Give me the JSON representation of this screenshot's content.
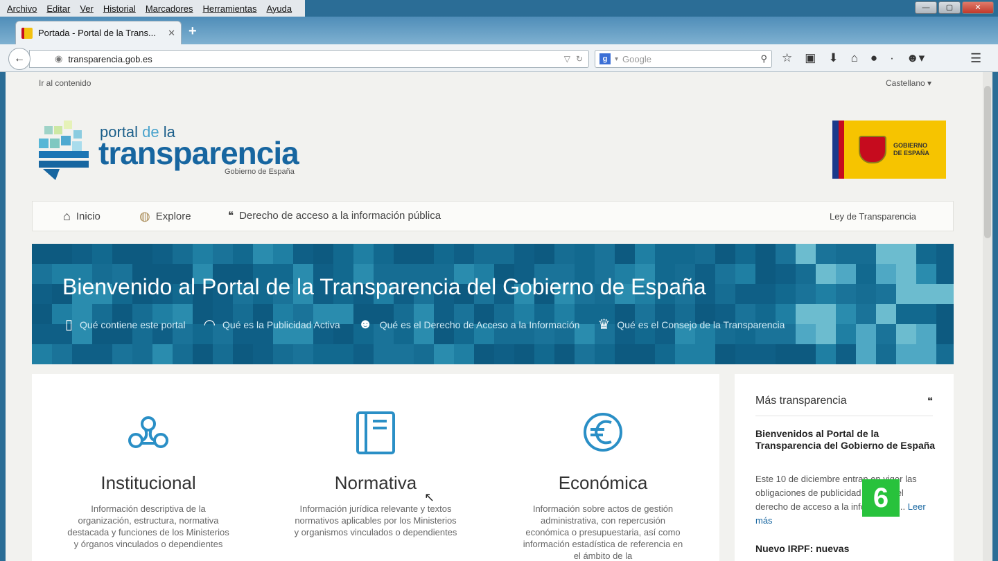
{
  "browser": {
    "menu": [
      "Archivo",
      "Editar",
      "Ver",
      "Historial",
      "Marcadores",
      "Herramientas",
      "Ayuda"
    ],
    "tab_title": "Portada - Portal de la Trans...",
    "url": "transparencia.gob.es",
    "search_placeholder": "Google"
  },
  "page": {
    "skip_link": "Ir al contenido",
    "language": "Castellano ▾",
    "logo": {
      "line1_a": "portal ",
      "line1_b": "de",
      "line1_c": " la",
      "line2": "transparencia",
      "sub": "Gobierno de España"
    },
    "gov_seal": {
      "line1": "GOBIERNO",
      "line2": "DE ESPAÑA"
    },
    "nav": {
      "inicio": "Inicio",
      "explore": "Explore",
      "derecho": "Derecho de acceso a la información pública",
      "ley": "Ley de Transparencia"
    },
    "hero": {
      "title": "Bienvenido al Portal de la Transparencia del Gobierno de España",
      "links": [
        "Qué contiene este portal",
        "Qué es la Publicidad Activa",
        "Qué es el Derecho de Acceso a la Información",
        "Qué es el Consejo de la Transparencia"
      ]
    },
    "columns": [
      {
        "title": "Institucional",
        "desc": "Información descriptiva de la organización, estructura, normativa destacada y funciones de los Ministerios y órganos vinculados o dependientes"
      },
      {
        "title": "Normativa",
        "desc": "Información jurídica relevante y textos normativos aplicables por los Ministerios y organismos vinculados o dependientes"
      },
      {
        "title": "Económica",
        "desc": "Información sobre actos de gestión administrativa, con repercusión económica o presupuestaria, así como información estadística de referencia en el ámbito de la"
      }
    ],
    "sidebar": {
      "heading": "Más transparencia",
      "news_title": "Bienvenidos al Portal de la Transparencia del Gobierno de España",
      "news_body": "Este 10 de diciembre entran en vigor las obligaciones de publicidad activa y el derecho de acceso a la información...",
      "read_more": "Leer más",
      "news2_title": "Nuevo IRPF: nuevas"
    },
    "tv_logo": "6"
  }
}
